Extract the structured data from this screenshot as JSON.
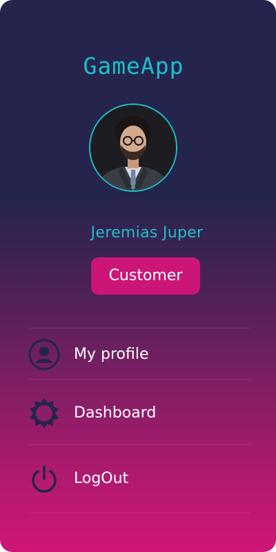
{
  "app": {
    "title": "GameApp"
  },
  "profile": {
    "name": "Jeremias Juper",
    "role": "Customer"
  },
  "menu": {
    "items": [
      {
        "label": "My profile",
        "icon": "user-icon"
      },
      {
        "label": "Dashboard",
        "icon": "gear-icon"
      },
      {
        "label": "LogOut",
        "icon": "power-icon"
      }
    ]
  },
  "colors": {
    "accent": "#1bc0c9",
    "badge": "#cc1677",
    "gradient_top": "#24244d",
    "gradient_bottom": "#cf1677",
    "icon": "#24244d"
  }
}
